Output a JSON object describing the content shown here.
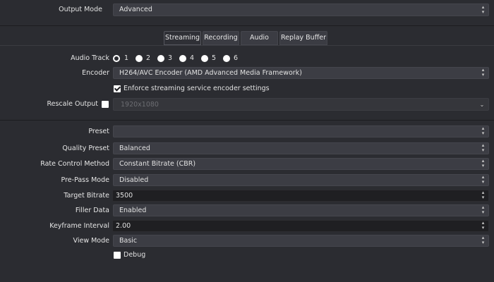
{
  "output_mode": {
    "label": "Output Mode",
    "value": "Advanced"
  },
  "tabs": [
    {
      "label": "Streaming",
      "active": true
    },
    {
      "label": "Recording",
      "active": false
    },
    {
      "label": "Audio",
      "active": false
    },
    {
      "label": "Replay Buffer",
      "active": false
    }
  ],
  "streaming": {
    "audio_track": {
      "label": "Audio Track",
      "options": [
        "1",
        "2",
        "3",
        "4",
        "5",
        "6"
      ],
      "selected": "1"
    },
    "encoder": {
      "label": "Encoder",
      "value": "H264/AVC Encoder (AMD Advanced Media Framework)"
    },
    "enforce": {
      "label": "Enforce streaming service encoder settings",
      "checked": true
    },
    "rescale": {
      "label": "Rescale Output",
      "checked": false,
      "value": "1920x1080"
    }
  },
  "encoder_settings": {
    "preset": {
      "label": "Preset",
      "value": ""
    },
    "quality_preset": {
      "label": "Quality Preset",
      "value": "Balanced"
    },
    "rate_control": {
      "label": "Rate Control Method",
      "value": "Constant Bitrate (CBR)"
    },
    "pre_pass": {
      "label": "Pre-Pass Mode",
      "value": "Disabled"
    },
    "target_bitrate": {
      "label": "Target Bitrate",
      "value": "3500"
    },
    "filler_data": {
      "label": "Filler Data",
      "value": "Enabled"
    },
    "keyframe_interval": {
      "label": "Keyframe Interval",
      "value": "2.00"
    },
    "view_mode": {
      "label": "View Mode",
      "value": "Basic"
    },
    "debug": {
      "label": "Debug",
      "checked": false
    }
  },
  "icons": {
    "combo": "updown-arrows-icon",
    "spin": "spin-arrows-icon",
    "dropdown": "chevron-down-icon"
  }
}
